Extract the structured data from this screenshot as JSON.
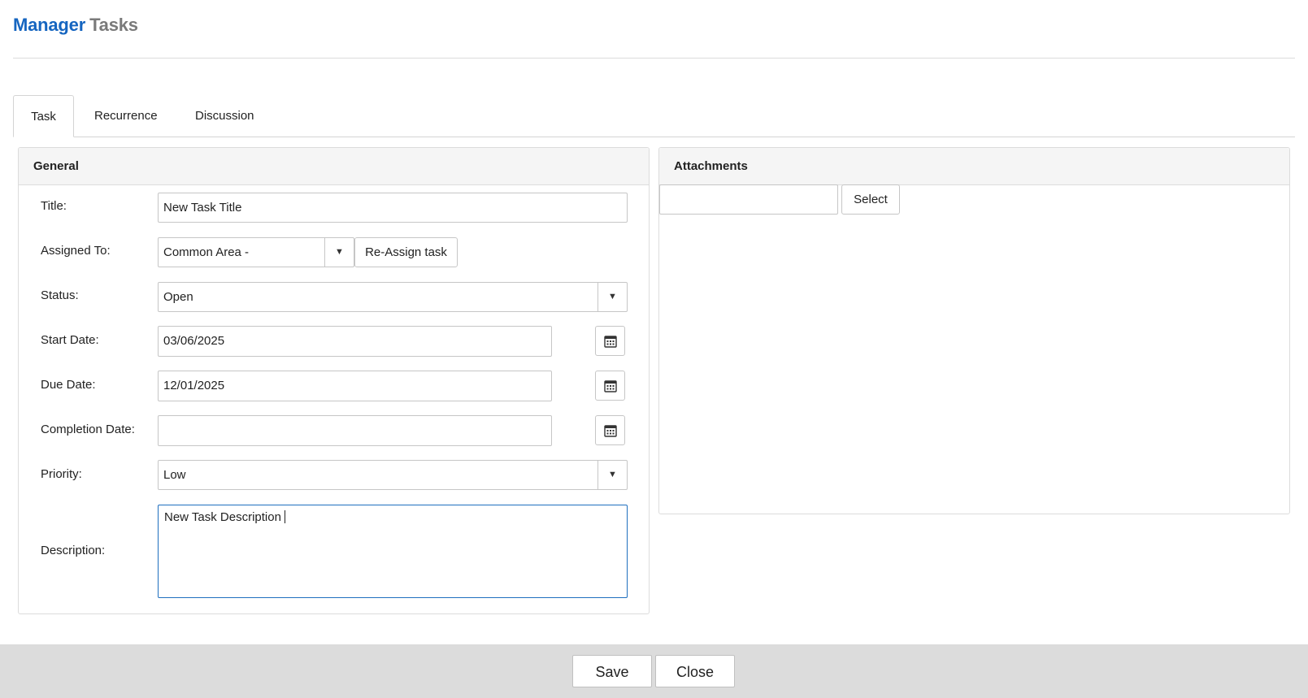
{
  "header": {
    "brand_primary": "Manager",
    "brand_secondary": "Tasks"
  },
  "tabs": [
    {
      "label": "Task",
      "active": true
    },
    {
      "label": "Recurrence",
      "active": false
    },
    {
      "label": "Discussion",
      "active": false
    }
  ],
  "general": {
    "heading": "General",
    "title": {
      "label": "Title:",
      "value": "New Task Title"
    },
    "assigned_to": {
      "label": "Assigned To:",
      "value": "Common Area -",
      "reassign_label": "Re-Assign task"
    },
    "status": {
      "label": "Status:",
      "value": "Open"
    },
    "start_date": {
      "label": "Start Date:",
      "value": "03/06/2025"
    },
    "due_date": {
      "label": "Due Date:",
      "value": "12/01/2025"
    },
    "completion_date": {
      "label": "Completion Date:",
      "value": ""
    },
    "priority": {
      "label": "Priority:",
      "value": "Low"
    },
    "description": {
      "label": "Description:",
      "value": "New Task Description"
    }
  },
  "attachments": {
    "heading": "Attachments",
    "file_value": "",
    "select_label": "Select"
  },
  "footer": {
    "save_label": "Save",
    "close_label": "Close"
  },
  "icons": {
    "dropdown": "chevron-down-icon",
    "calendar": "calendar-icon"
  },
  "colors": {
    "brand_primary": "#1565c0",
    "brand_secondary": "#7a7a7a",
    "focus_border": "#1f6fbf",
    "footer_bg": "#dcdcdc"
  }
}
